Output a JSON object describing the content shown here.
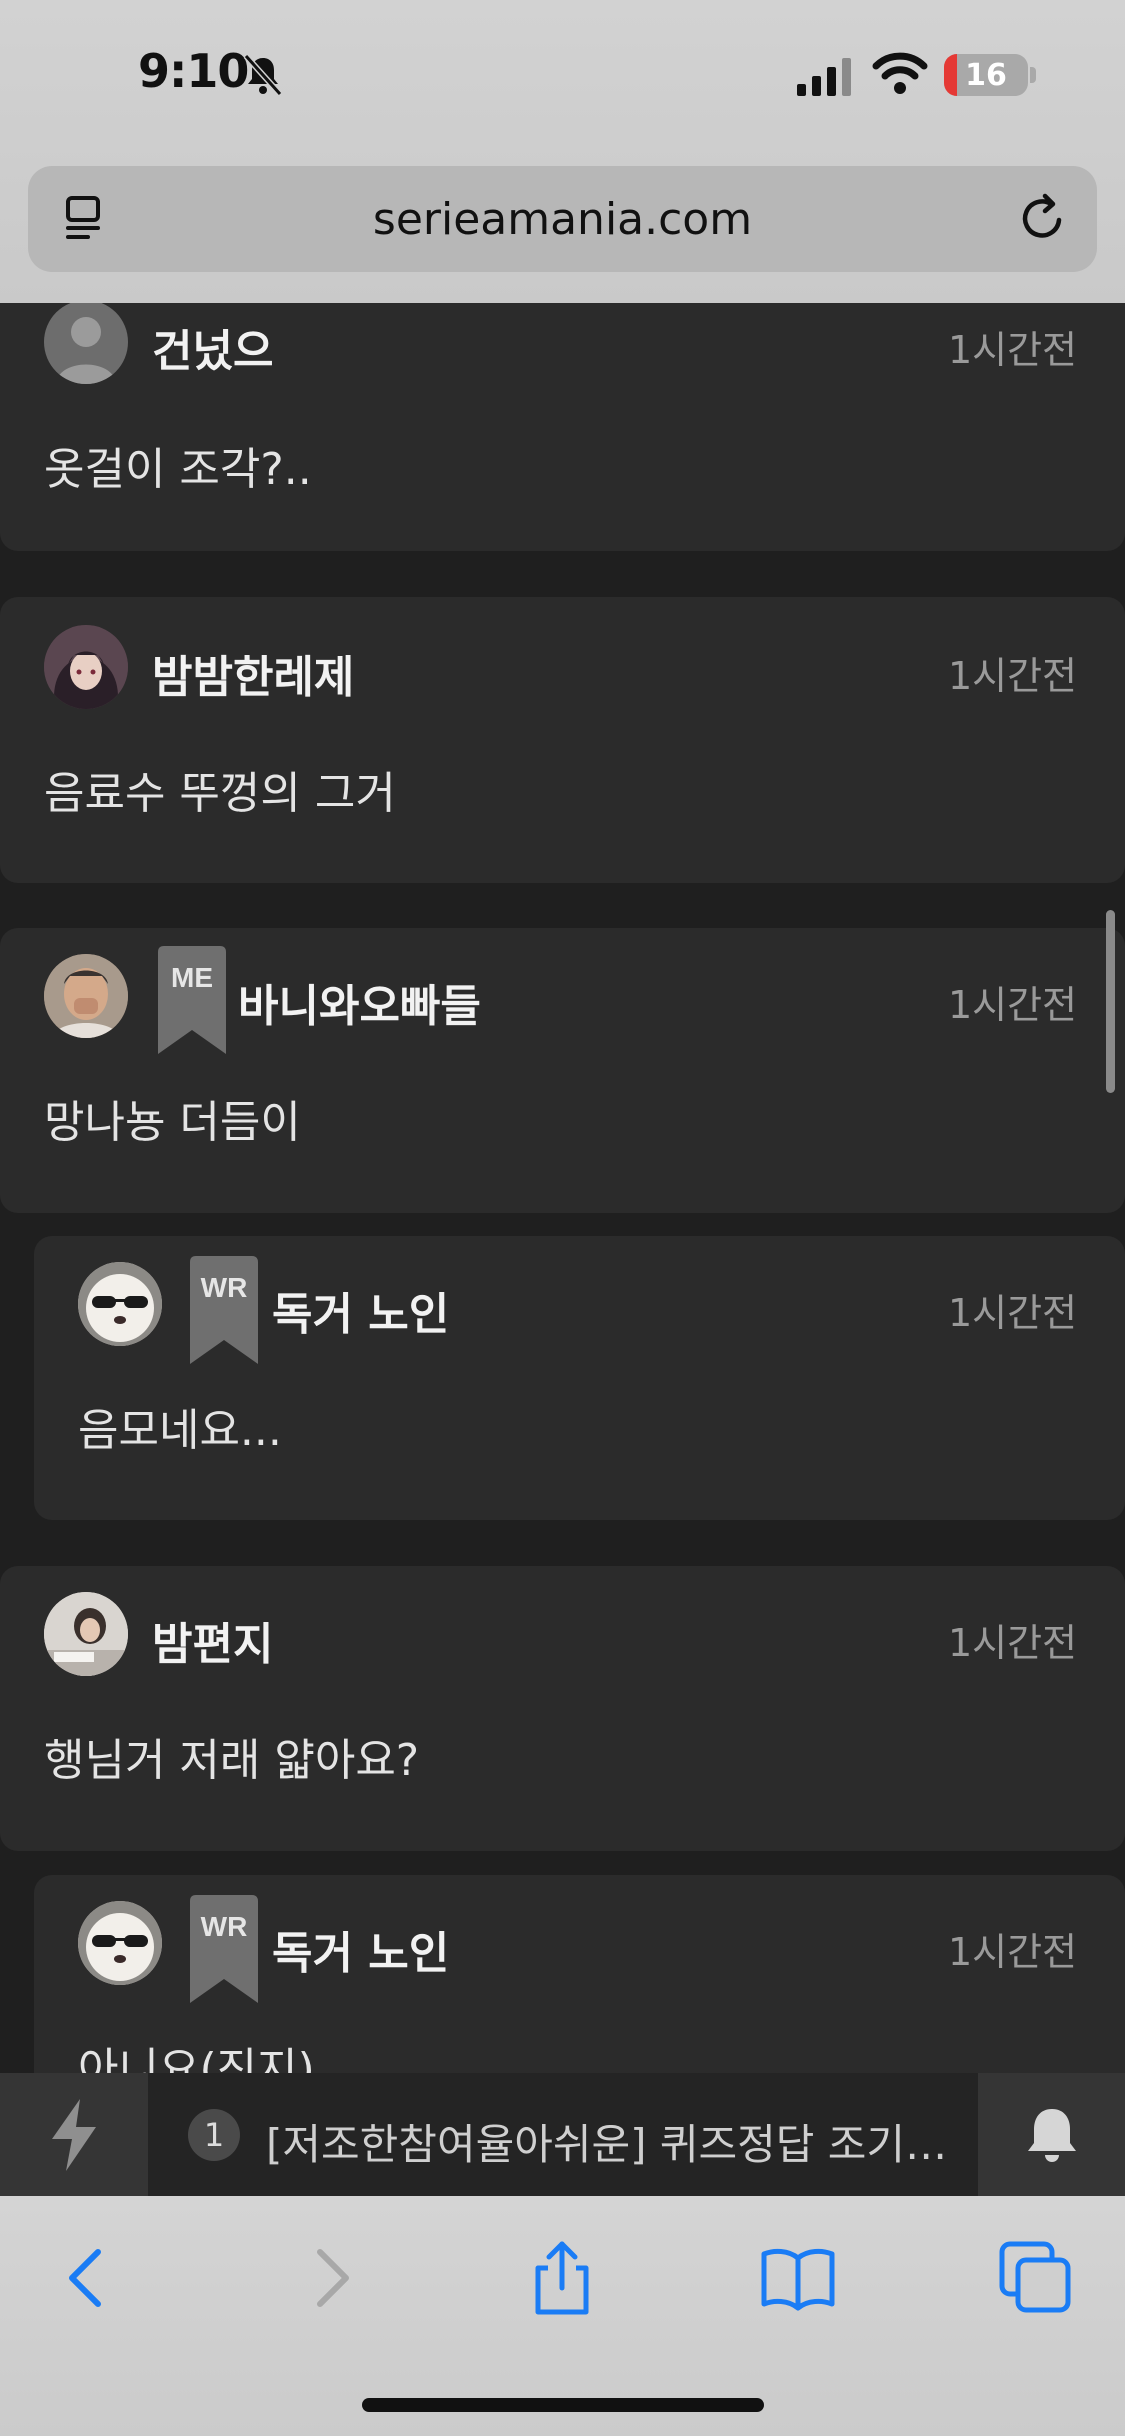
{
  "status_bar": {
    "time": "9:10",
    "battery": "16"
  },
  "browser": {
    "url": "serieamania.com"
  },
  "comments": [
    {
      "author": "건넜으",
      "time": "1시간전",
      "text": "옷걸이 조각?.."
    },
    {
      "author": "밤밤한레제",
      "time": "1시간전",
      "text": "음료수 뚜껑의 그거"
    },
    {
      "author": "바니와오빠들",
      "badge": "ME",
      "time": "1시간전",
      "text": "망나뇽 더듬이"
    },
    {
      "author": "독거 노인",
      "badge": "WR",
      "time": "1시간전",
      "text": "음모네요..."
    },
    {
      "author": "밤편지",
      "time": "1시간전",
      "text": "행님거 저래 얇아요?"
    },
    {
      "author": "독거 노인",
      "badge": "WR",
      "time": "1시간전",
      "text": "아니요(진지)"
    }
  ],
  "notice": {
    "count": "1",
    "text": "[저조한참여율아쉬운] 퀴즈정답 조기…"
  },
  "colors": {
    "accent_blue": "#1a7cf5",
    "battery_red": "#e53935",
    "page_bg": "#1f1f1f",
    "card_bg": "#2b2b2b"
  },
  "icons": {
    "toolbar": [
      "back-icon",
      "forward-icon",
      "share-icon",
      "bookmarks-icon",
      "tabs-icon"
    ],
    "notice": [
      "lightning-icon",
      "bell-icon"
    ]
  }
}
